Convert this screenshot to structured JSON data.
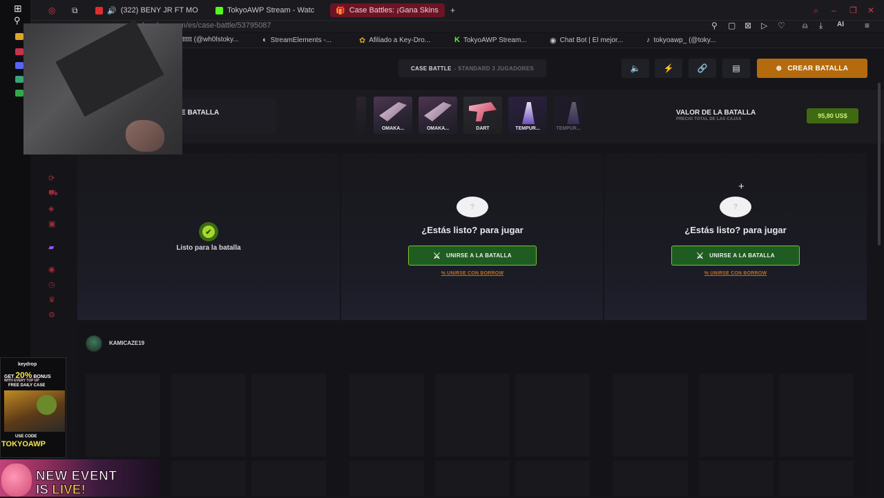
{
  "browser": {
    "tabs": [
      {
        "label": "(322) BENY JR FT MO",
        "icon": "youtube-icon",
        "color": "#e22b2b"
      },
      {
        "label": "TokyoAWP Stream - Watc",
        "icon": "kick-icon",
        "color": "#53fc18"
      },
      {
        "label": "Case Battles: ¡Gana Skins",
        "icon": "gift-icon",
        "color": "#e86a6a"
      }
    ],
    "url": "keydrop.com/es/case-battle/53795087",
    "bookmarks": [
      {
        "label": "ttttt (@wh0lstoky...",
        "icon": "tiktok-icon"
      },
      {
        "label": "StreamElements -...",
        "icon": "streamelements-icon"
      },
      {
        "label": "Afiliado a Key-Dro...",
        "icon": "keydrop-icon"
      },
      {
        "label": "TokyoAWP Stream...",
        "icon": "kick-icon"
      },
      {
        "label": "Chat Bot | El mejor...",
        "icon": "chatbot-icon"
      },
      {
        "label": "tokyoawp_ (@toky...",
        "icon": "tiktok-icon"
      }
    ],
    "ai_label": "AI"
  },
  "header": {
    "mode_main": "CASE BATTLE",
    "mode_sub": "- STANDARD 3 JUGADORES",
    "create_label": "CREAR BATALLA"
  },
  "info": {
    "battle_title": "E BATALLA",
    "cases": [
      "OMAKA...",
      "OMAKA...",
      "DART",
      "TEMPUR...",
      "TEMPUR..."
    ],
    "value_label": "VALOR DE LA BATALLA",
    "value_sub": "PRECIO TOTAL DE LAS CAJAS",
    "value": "95,80 US$"
  },
  "columns": {
    "ready_label": "Listo para la batalla",
    "question_mark": "?",
    "ready_question": "¿Estás listo? para jugar",
    "join_label": "UNIRSE A LA BATALLA",
    "borrow_label": "% UNIRSE CON BORROW",
    "check": "✔"
  },
  "player": {
    "name": "KAMICAZE19"
  },
  "promo": {
    "brand": "keydrop",
    "get": "GET",
    "pct": "20%",
    "bonus": "BONUS",
    "every": "WITH EVERY TOP UP",
    "free": "FREE DAILY CASE",
    "use": "USE CODE",
    "code": "TOKYOAWP"
  },
  "event": {
    "line1": "NEW EVENT",
    "is": "IS",
    "live": "LIVE!"
  },
  "colors": {
    "accent": "#b46b0d",
    "join_border": "#7ec32b",
    "value_bg": "#3f6a12"
  }
}
